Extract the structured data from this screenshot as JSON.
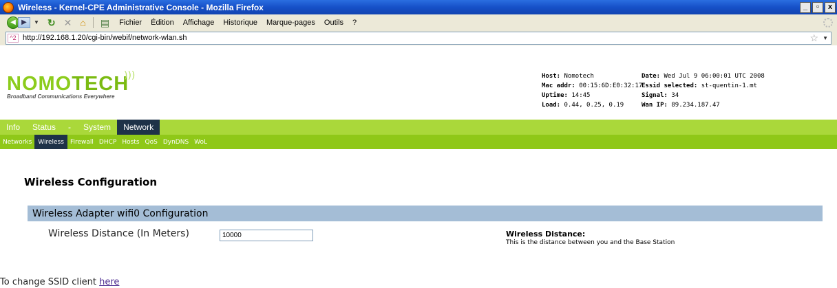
{
  "window": {
    "title": "Wireless - Kernel-CPE Administrative Console - Mozilla Firefox",
    "buttons": {
      "minimize": "_",
      "maximize": "▫",
      "close": "x"
    }
  },
  "browser": {
    "menu": [
      "Fichier",
      "Édition",
      "Affichage",
      "Historique",
      "Marque-pages",
      "Outils",
      "?"
    ],
    "url": "http://192.168.1.20/cgi-bin/webif/network-wlan.sh",
    "site_badge": "^2"
  },
  "header": {
    "logo_word_a": "NOMO",
    "logo_word_b": "TECH",
    "logo_tagline": "Broadband Communications Everywhere",
    "info": {
      "host_label": "Host:",
      "host": "Nomotech",
      "date_label": "Date:",
      "date": "Wed Jul 9 06:00:01 UTC 2008",
      "mac_label": "Mac addr:",
      "mac": "00:15:6D:E0:32:17",
      "essid_label": "Essid selected:",
      "essid": "st-quentin-1.mt",
      "uptime_label": "Uptime:",
      "uptime": "14:45",
      "signal_label": "Signal:",
      "signal": "34",
      "load_label": "Load:",
      "load": "0.44, 0.25, 0.19",
      "wan_label": "Wan IP:",
      "wan": "89.234.187.47"
    }
  },
  "nav": {
    "main": [
      "Info",
      "Status",
      "-",
      "System",
      "Network"
    ],
    "main_active": "Network",
    "sub": [
      "Networks",
      "Wireless",
      "Firewall",
      "DHCP",
      "Hosts",
      "QoS",
      "DynDNS",
      "WoL"
    ],
    "sub_active": "Wireless"
  },
  "content": {
    "heading": "Wireless Configuration",
    "section_title": "Wireless Adapter wifi0 Configuration",
    "distance_label": "Wireless Distance (In Meters)",
    "distance_value": "10000",
    "help_title": "Wireless Distance:",
    "help_text": "This is the distance between you and the Base Station",
    "ssid_prefix": "To change SSID client ",
    "ssid_link": "here"
  },
  "colors": {
    "titlebar": "#1650c8",
    "nav_green": "#aad83a",
    "subnav_green": "#8fc818",
    "active_tab": "#1e3248",
    "section_bar": "#a4bdd6",
    "logo_green": "#8ccc1c"
  }
}
